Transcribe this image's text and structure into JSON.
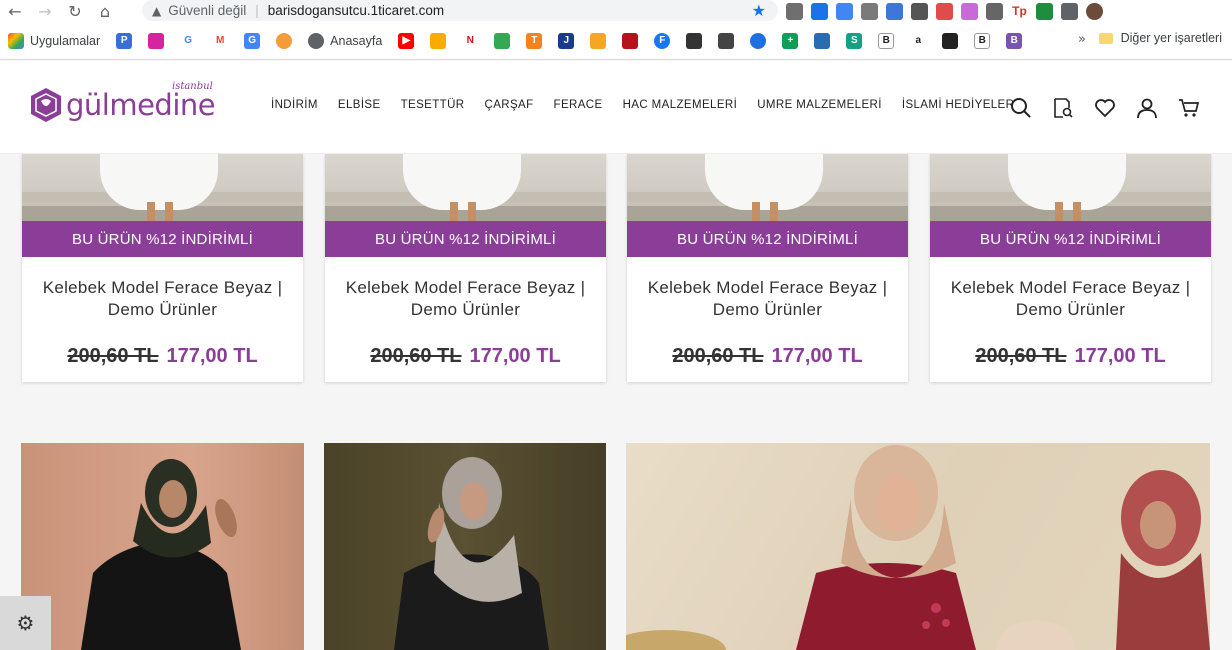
{
  "browser": {
    "security_label": "Güvenli değil",
    "url": "barisdogansutcu.1ticaret.com",
    "bookmarks": [
      {
        "label": "Uygulamalar",
        "icon": "apps-grid-icon"
      },
      {
        "label": "",
        "icon": "bookmark-p-icon"
      },
      {
        "label": "",
        "icon": "instagram-icon"
      },
      {
        "label": "",
        "icon": "google-icon"
      },
      {
        "label": "",
        "icon": "gmail-icon"
      },
      {
        "label": "",
        "icon": "translate-icon"
      },
      {
        "label": "",
        "icon": "cloud-icon"
      },
      {
        "label": "Anasayfa",
        "icon": "globe-icon"
      },
      {
        "label": "",
        "icon": "youtube-icon"
      }
    ],
    "other_bookmarks": "Diğer yer işaretleri"
  },
  "site": {
    "logo_text": "gülmedine",
    "logo_sub": "istanbul",
    "menu": [
      "İNDİRİM",
      "ELBİSE",
      "TESETTÜR",
      "ÇARŞAF",
      "FERACE",
      "HAC MALZEMELERİ",
      "UMRE MALZEMELERİ",
      "İSLAMİ HEDİYELER"
    ]
  },
  "products": [
    {
      "badge": "BU ÜRÜN %12 İNDİRİMLİ",
      "title": "Kelebek Model Ferace Beyaz | Demo Ürünler",
      "old_price": "200,60 TL",
      "price": "177,00 TL"
    },
    {
      "badge": "BU ÜRÜN %12 İNDİRİMLİ",
      "title": "Kelebek Model Ferace Beyaz | Demo Ürünler",
      "old_price": "200,60 TL",
      "price": "177,00 TL"
    },
    {
      "badge": "BU ÜRÜN %12 İNDİRİMLİ",
      "title": "Kelebek Model Ferace Beyaz | Demo Ürünler",
      "old_price": "200,60 TL",
      "price": "177,00 TL"
    },
    {
      "badge": "BU ÜRÜN %12 İNDİRİMLİ",
      "title": "Kelebek Model Ferace Beyaz | Demo Ürünler",
      "old_price": "200,60 TL",
      "price": "177,00 TL"
    }
  ],
  "colors": {
    "brand": "#8a3e97"
  }
}
